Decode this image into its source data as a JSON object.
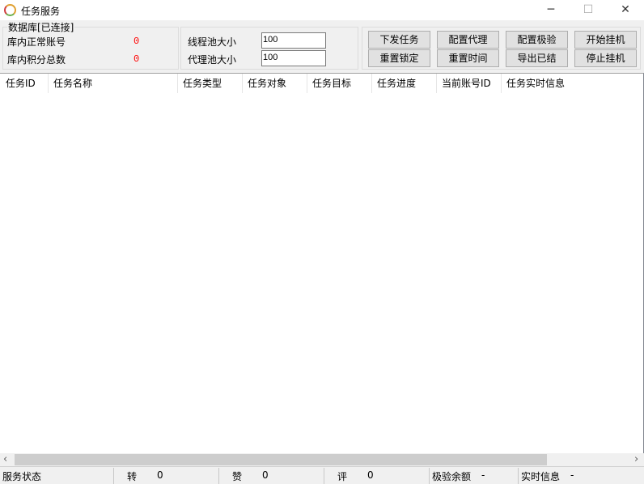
{
  "window": {
    "title": "任务服务",
    "minimize": "─",
    "maximize": "☐",
    "close": "✕"
  },
  "database": {
    "group_label": "数据库[已连接]",
    "normal_accounts_label": "库内正常账号",
    "normal_accounts_value": "0",
    "points_total_label": "库内积分总数",
    "points_total_value": "0"
  },
  "pools": {
    "thread_pool_label": "线程池大小",
    "thread_pool_value": "100",
    "proxy_pool_label": "代理池大小",
    "proxy_pool_value": "100"
  },
  "buttons": [
    "下发任务",
    "配置代理",
    "配置极验",
    "开始挂机",
    "重置锁定",
    "重置时间",
    "导出已结",
    "停止挂机"
  ],
  "columns": [
    "任务ID",
    "任务名称",
    "任务类型",
    "任务对象",
    "任务目标",
    "任务进度",
    "当前账号ID",
    "任务实时信息"
  ],
  "scroll": {
    "left": "‹",
    "right": "›"
  },
  "status": {
    "service_state": "服务状态",
    "forward_label": "转",
    "forward_value": "0",
    "like_label": "赞",
    "like_value": "0",
    "comment_label": "评",
    "comment_value": "0",
    "geetest_label": "极验余额",
    "geetest_value": "-",
    "realtime_label": "实时信息",
    "realtime_value": "-"
  }
}
